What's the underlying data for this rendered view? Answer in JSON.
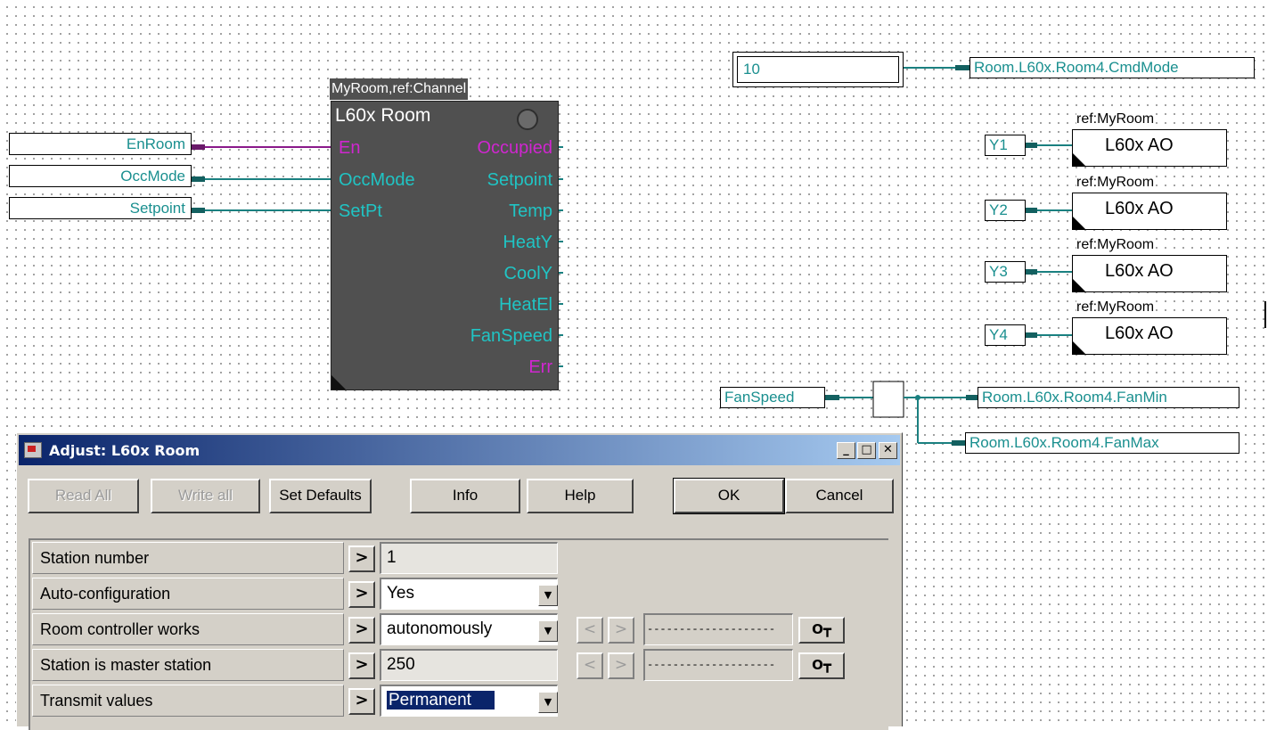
{
  "inputs": {
    "enroom": "EnRoom",
    "occmode": "OccMode",
    "setpoint": "Setpoint"
  },
  "block": {
    "tag": "MyRoom,ref:Channel",
    "title": "L60x Room",
    "pins_in": [
      "En",
      "OccMode",
      "SetPt"
    ],
    "pins_out": [
      "Occupied",
      "Setpoint",
      "Temp",
      "HeatY",
      "CoolY",
      "HeatEl",
      "FanSpeed",
      "Err"
    ]
  },
  "cmd": {
    "value": "10",
    "target": "Room.L60x.Room4.CmdMode"
  },
  "ao": {
    "ref_label": "ref:MyRoom",
    "title": "L60x AO",
    "signals": [
      "Y1",
      "Y2",
      "Y3",
      "Y4"
    ]
  },
  "fan": {
    "source": "FanSpeed",
    "targets": [
      "Room.L60x.Room4.FanMin",
      "Room.L60x.Room4.FanMax"
    ]
  },
  "dialog": {
    "title": "Adjust: L60x Room",
    "buttons": {
      "read_all": "Read All",
      "write_all": "Write all",
      "set_defaults": "Set Defaults",
      "info": "Info",
      "help": "Help",
      "ok": "OK",
      "cancel": "Cancel"
    },
    "params": [
      {
        "label": "Station number",
        "value": "1"
      },
      {
        "label": "Auto-configuration",
        "value": "Yes"
      },
      {
        "label": "Room controller works",
        "value": "autonomously",
        "range": "--------------------"
      },
      {
        "label": "Station is master station",
        "value": "250",
        "range": "--------------------"
      },
      {
        "label": "Transmit values",
        "value": "Permanent"
      }
    ]
  },
  "colors": {
    "wire_teal": "#1a8080",
    "wire_purple": "#8a1a8a",
    "block_gray": "#505050",
    "pin_cyan": "#20c4c4",
    "pin_magenta": "#d026d0"
  }
}
